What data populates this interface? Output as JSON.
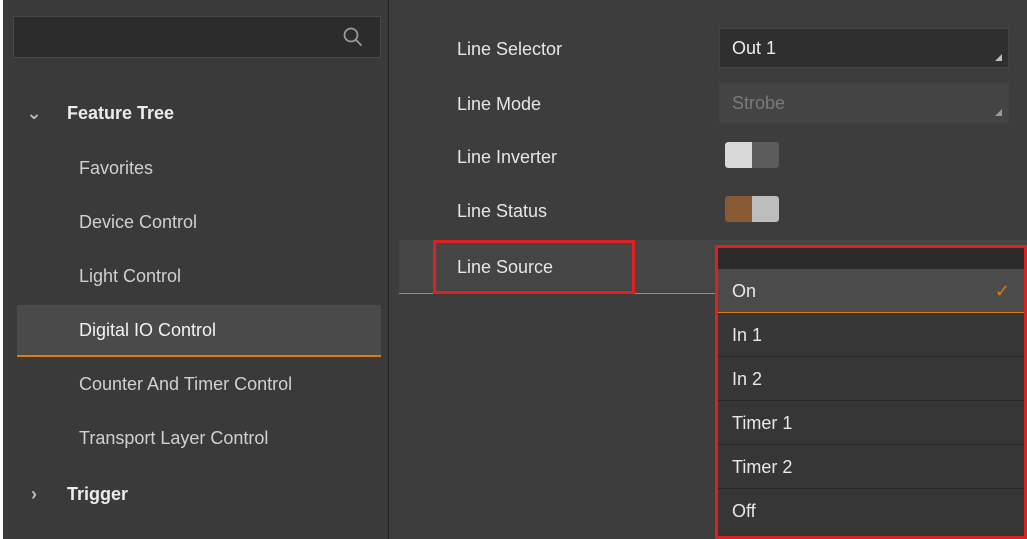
{
  "search": {
    "placeholder": ""
  },
  "tree": {
    "group_label": "Feature Tree",
    "items": [
      {
        "label": "Favorites"
      },
      {
        "label": "Device Control"
      },
      {
        "label": "Light Control"
      },
      {
        "label": "Digital IO Control"
      },
      {
        "label": "Counter And Timer Control"
      },
      {
        "label": "Transport Layer Control"
      }
    ],
    "collapsed_group_label": "Trigger"
  },
  "properties": {
    "line_selector": {
      "label": "Line Selector",
      "value": "Out 1"
    },
    "line_mode": {
      "label": "Line Mode",
      "value": "Strobe"
    },
    "line_inverter": {
      "label": "Line Inverter",
      "state": "off"
    },
    "line_status": {
      "label": "Line Status",
      "state": "on"
    },
    "line_source": {
      "label": "Line Source"
    }
  },
  "dropdown": {
    "options": [
      {
        "label": "On",
        "selected": true
      },
      {
        "label": "In 1"
      },
      {
        "label": "In 2"
      },
      {
        "label": "Timer 1"
      },
      {
        "label": "Timer 2"
      },
      {
        "label": "Off"
      }
    ],
    "check_glyph": "✓"
  },
  "colors": {
    "accent": "#e07a14",
    "highlight_border": "#e02020",
    "panel_bg": "#3b3b3b"
  }
}
